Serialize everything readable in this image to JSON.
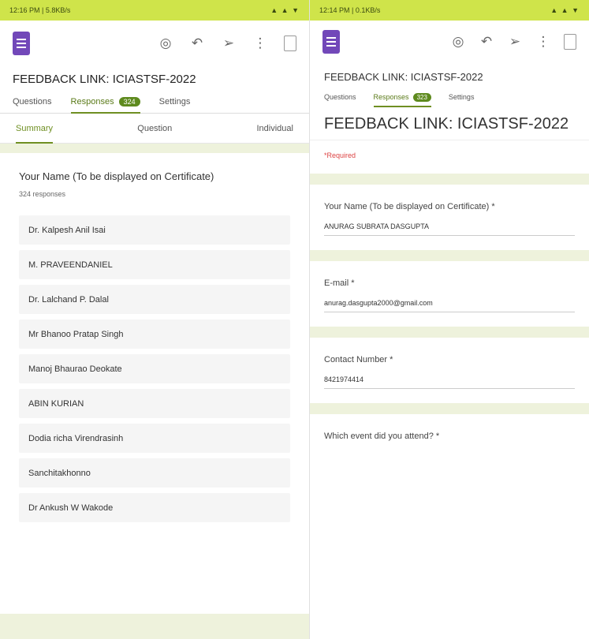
{
  "left": {
    "status": {
      "left": "12:16 PM | 5.8KB/s",
      "right": "▲ ▲ ▼"
    },
    "form_title": "FEEDBACK LINK: ICIASTSF-2022",
    "tabs": {
      "questions": "Questions",
      "responses": "Responses",
      "responses_count": "324",
      "settings": "Settings"
    },
    "subtabs": {
      "summary": "Summary",
      "question": "Question",
      "individual": "Individual"
    },
    "question": {
      "title": "Your Name (To be displayed on Certificate)",
      "count": "324 responses",
      "responses": [
        "Dr. Kalpesh Anil Isai",
        "M. PRAVEENDANIEL",
        "Dr. Lalchand P. Dalal",
        "Mr Bhanoo Pratap Singh",
        "Manoj Bhaurao Deokate",
        "ABIN KURIAN",
        "Dodia richa Virendrasinh",
        "Sanchitakhonno",
        "Dr Ankush W Wakode"
      ]
    }
  },
  "right": {
    "status": {
      "left": "12:14 PM | 0.1KB/s",
      "right": "▲ ▲ ▼"
    },
    "form_title": "FEEDBACK LINK: ICIASTSF-2022",
    "tabs": {
      "questions": "Questions",
      "responses": "Responses",
      "responses_count": "323",
      "settings": "Settings"
    },
    "header_title": "FEEDBACK LINK: ICIASTSF-2022",
    "required": "*Required",
    "fields": [
      {
        "label": "Your Name (To be displayed on Certificate) *",
        "answer": "ANURAG SUBRATA DASGUPTA"
      },
      {
        "label": "E-mail *",
        "answer": "anurag.dasgupta2000@gmail.com"
      },
      {
        "label": "Contact Number *",
        "answer": "8421974414"
      }
    ],
    "last_question": "Which event did you attend? *"
  },
  "icons": [
    "forms-logo-icon",
    "palette-icon",
    "undo-icon",
    "send-icon",
    "more-vert-icon",
    "preview-icon"
  ],
  "colors": {
    "status_bar": "#cfe44a",
    "accent": "#6f8f22",
    "band": "#eef2dc",
    "forms_purple": "#7248b9"
  }
}
